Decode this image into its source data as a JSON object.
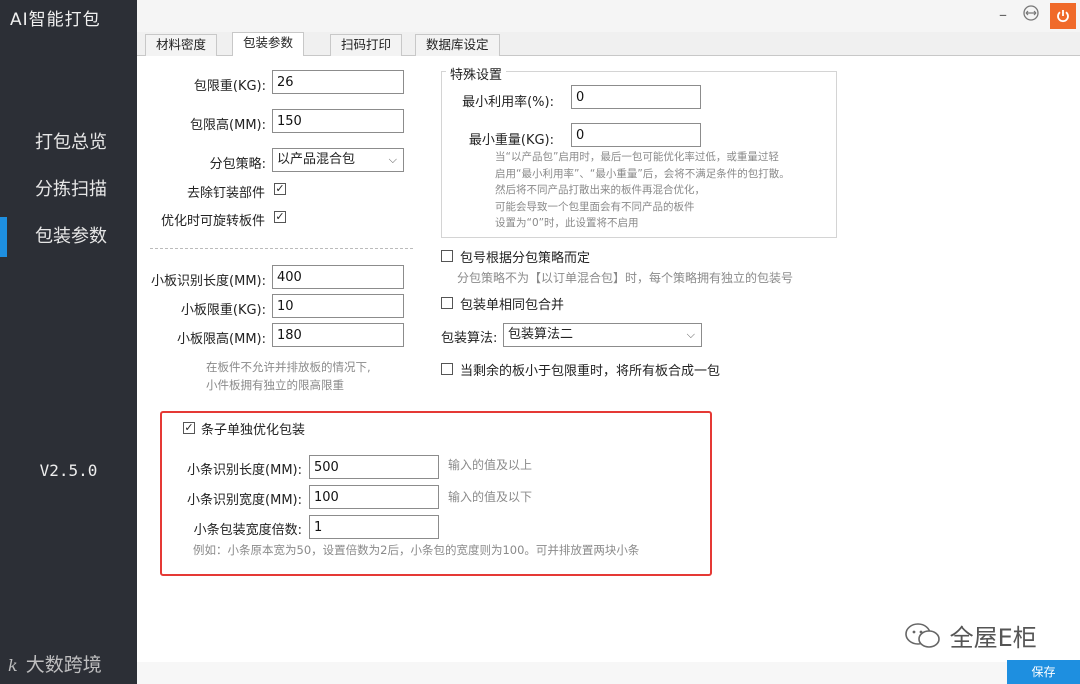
{
  "app": {
    "title": "AI智能打包",
    "version": "V2.5.0"
  },
  "sidebar": {
    "items": [
      {
        "label": "打包总览"
      },
      {
        "label": "分拣扫描"
      },
      {
        "label": "包装参数"
      }
    ]
  },
  "tabs": [
    {
      "label": "材料密度"
    },
    {
      "label": "包装参数"
    },
    {
      "label": "扫码打印"
    },
    {
      "label": "数据库设定"
    }
  ],
  "left": {
    "pkg_weight_label": "包限重(KG):",
    "pkg_weight_value": "26",
    "pkg_height_label": "包限高(MM):",
    "pkg_height_value": "150",
    "strategy_label": "分包策略:",
    "strategy_value": "以产品混合包",
    "remove_nail_label": "去除钉装部件",
    "rotate_label": "优化时可旋转板件",
    "small_len_label": "小板识别长度(MM):",
    "small_len_value": "400",
    "small_weight_label": "小板限重(KG):",
    "small_weight_value": "10",
    "small_height_label": "小板限高(MM):",
    "small_height_value": "180",
    "note_line1": "在板件不允许并排放板的情况下,",
    "note_line2": "小件板拥有独立的限高限重"
  },
  "special": {
    "title": "特殊设置",
    "min_util_label": "最小利用率(%):",
    "min_util_value": "0",
    "min_weight_label": "最小重量(KG):",
    "min_weight_value": "0",
    "note_lines": [
      "当“以产品包”启用时，最后一包可能优化率过低，或重量过轻",
      "启用“最小利用率”、“最小重量”后，会将不满足条件的包打散。",
      "然后将不同产品打散出来的板件再混合优化，",
      "可能会导致一个包里面会有不同产品的板件",
      "设置为“0”时，此设置将不启用"
    ]
  },
  "right": {
    "pkg_no_label": "包号根据分包策略而定",
    "pkg_no_note": "分包策略不为【以订单混合包】时，每个策略拥有独立的包装号",
    "merge_label": "包装单相同包合并",
    "algo_label": "包装算法:",
    "algo_value": "包装算法二",
    "remaining_label": "当剩余的板小于包限重时，将所有板合成一包"
  },
  "strip": {
    "enable_label": "条子单独优化包装",
    "len_label": "小条识别长度(MM):",
    "len_value": "500",
    "len_hint": "输入的值及以上",
    "width_label": "小条识别宽度(MM):",
    "width_value": "100",
    "width_hint": "输入的值及以下",
    "multiple_label": "小条包装宽度倍数:",
    "multiple_value": "1",
    "example": "例如：小条原本宽为50，设置倍数为2后，小条包的宽度则为100。可并排放置两块小条"
  },
  "footer": {
    "save_label": "保存",
    "watermark_left": "大数跨境",
    "watermark_left_mark": "k",
    "watermark_right": "全屋E柜"
  },
  "checks": {
    "remove_nail": true,
    "rotate": true,
    "pkg_no": false,
    "merge": false,
    "remaining": false,
    "strip_enable": true
  },
  "colors": {
    "sidebar_bg": "#2c2f36",
    "accent": "#1e8fe0",
    "highlight_border": "#e53935",
    "power_button": "#f06a2a"
  }
}
